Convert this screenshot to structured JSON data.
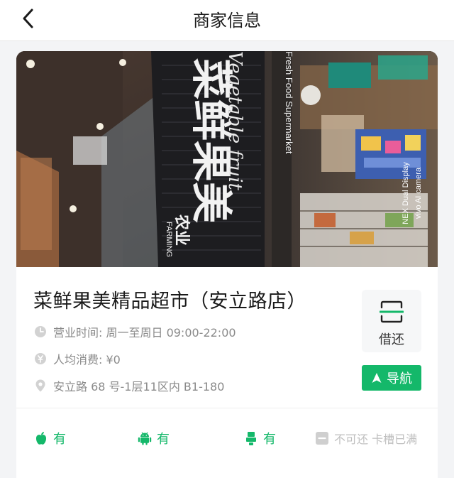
{
  "header": {
    "title": "商家信息",
    "back_icon": "chevron-left-icon"
  },
  "store": {
    "name": "菜鲜果美精品超市（安立路店）",
    "hours": "营业时间: 周一至周日 09:00-22:00",
    "avg_spend": "人均消费: ¥0",
    "address": "安立路 68 号-1层11区内 B1-180"
  },
  "photo": {
    "sign_text": "菜鲜果美",
    "sign_subtitle": "Vegetable fruit",
    "sign_small": "农业",
    "sign_small_en": "FARMING",
    "banner_text": "Fresh Food Supermarket",
    "watermark_line1": "NEX Dual Display",
    "watermark_line2": "vivo AI camera"
  },
  "actions": {
    "borrow_label": "借还",
    "navigate_label": "导航"
  },
  "features": [
    {
      "icon": "apple-icon",
      "label": "有"
    },
    {
      "icon": "android-icon",
      "label": "有"
    },
    {
      "icon": "lightning-cable-icon",
      "label": "有"
    },
    {
      "icon": "minus-box-icon",
      "label": "不可还 卡槽已满"
    }
  ],
  "colors": {
    "accent": "#14b86a",
    "muted": "#8a8a8a",
    "disabled": "#bfbfbf"
  }
}
